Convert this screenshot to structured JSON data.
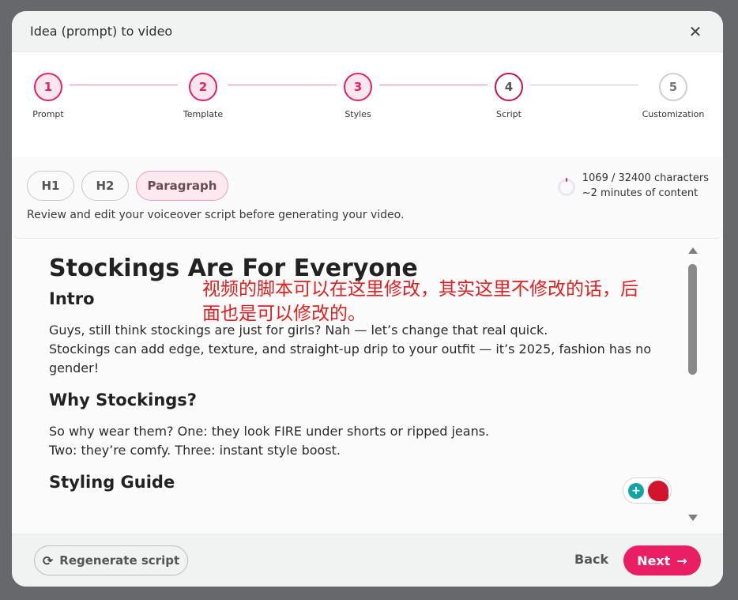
{
  "modal": {
    "title": "Idea (prompt) to video",
    "close_icon": "close-icon"
  },
  "stepper": {
    "steps": [
      {
        "number": "1",
        "label": "Prompt",
        "state": "done"
      },
      {
        "number": "2",
        "label": "Template",
        "state": "done"
      },
      {
        "number": "3",
        "label": "Styles",
        "state": "done"
      },
      {
        "number": "4",
        "label": "Script",
        "state": "active"
      },
      {
        "number": "5",
        "label": "Customization",
        "state": "todo"
      }
    ]
  },
  "toolbar": {
    "format_buttons": [
      "H1",
      "H2",
      "Paragraph"
    ],
    "selected_format": "Paragraph",
    "help_text": "Review and edit your voiceover script before generating your video.",
    "char_count": "1069 / 32400 characters",
    "duration": "~2 minutes of content"
  },
  "script": {
    "title": "Stockings Are For Everyone",
    "sections": [
      {
        "heading": "Intro",
        "paragraphs": [
          "Guys, still think stockings are just for girls? Nah — let’s change that real quick.",
          "Stockings can add edge, texture, and straight-up drip to your outfit — it’s 2025, fashion has no gender!"
        ]
      },
      {
        "heading": "Why Stockings?",
        "paragraphs": [
          "So why wear them? One: they look FIRE under shorts or ripped jeans.",
          "Two: they’re comfy. Three: instant style boost."
        ]
      },
      {
        "heading": "Styling Guide",
        "paragraphs": []
      }
    ]
  },
  "annotation": "视频的脚本可以在这里修改，其实这里不修改的话，后面也是可以修改的。",
  "footer": {
    "regenerate_label": "Regenerate script",
    "back_label": "Back",
    "next_label": "Next"
  },
  "colors": {
    "accent": "#e91e63",
    "step_done_bg": "#fde7ee",
    "annotation": "#e02020"
  }
}
